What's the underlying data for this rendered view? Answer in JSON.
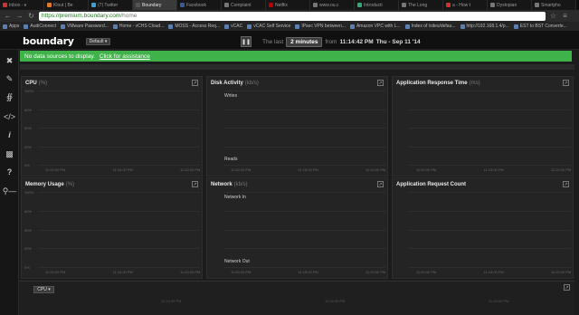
{
  "browser": {
    "tabs": [
      {
        "label": "Inbox - e",
        "color": "#c33"
      },
      {
        "label": "Klout | Be",
        "color": "#e07a2a"
      },
      {
        "label": "(7) Twitter",
        "color": "#3ba0d8"
      },
      {
        "label": "Boundary",
        "color": "#555",
        "active": true
      },
      {
        "label": "Facebook",
        "color": "#3b5998"
      },
      {
        "label": "Complaint",
        "color": "#777"
      },
      {
        "label": "Netflix",
        "color": "#b00"
      },
      {
        "label": "www.ou.c",
        "color": "#777"
      },
      {
        "label": "Introducti",
        "color": "#3a7"
      },
      {
        "label": "The Long",
        "color": "#777"
      },
      {
        "label": "a - How t",
        "color": "#c33"
      },
      {
        "label": "Dystopian",
        "color": "#777"
      },
      {
        "label": "Smartpho",
        "color": "#777"
      }
    ],
    "url_host": "https://premium.boundary.com",
    "url_path": "/home",
    "bookmarks": [
      "Apps",
      "AudiConnect",
      "VMware Password...",
      "Home - vCHS Cloud...",
      "MOSS - Access Req...",
      "vCAC",
      "vCAC Self Service",
      "IPsec VPN between...",
      "Amazon VPC with L...",
      "Index of /sites/defau...",
      "http://192.168.1.4/p...",
      "EST to BST Converte..."
    ]
  },
  "header": {
    "logo": "boundary",
    "dashboard_select": "Default",
    "pause_icon": "pause-icon",
    "time_prefix": "The last",
    "duration": "2 minutes",
    "from_word": "from",
    "start_time": "11:14:42 PM",
    "date": "Thu - Sep 11 '14"
  },
  "sidebar": {
    "icons": [
      "tools-icon",
      "pencil-icon",
      "share-icon",
      "code-icon",
      "info-icon",
      "chat-icon",
      "help-icon",
      "key-icon"
    ]
  },
  "alert": {
    "text": "No data sources to display.",
    "link": "Click for assistance",
    "color": "#3fb249"
  },
  "panels": [
    {
      "id": "cpu",
      "title": "CPU",
      "unit": "(%)",
      "yticks": [
        "100%",
        "80%",
        "50%",
        "20%",
        "0%"
      ],
      "xticks": [
        "11:00:00 PM",
        "11:15:00 PM",
        "11:20:00 PM"
      ],
      "labels": []
    },
    {
      "id": "disk",
      "title": "Disk Activity",
      "unit": "(kb/s)",
      "yticks": [
        "",
        "",
        "",
        "",
        ""
      ],
      "xticks": [
        "11:00:00 PM",
        "11:15:00 PM",
        "11:20:00 PM"
      ],
      "labels": [
        "Writes",
        "Reads"
      ]
    },
    {
      "id": "art",
      "title": "Application Response Time",
      "unit": "(ms)",
      "yticks": [
        "",
        "",
        "",
        "",
        ""
      ],
      "xticks": [
        "11:00:00 PM",
        "11:15:00 PM",
        "11:20:00 PM"
      ],
      "labels": []
    },
    {
      "id": "mem",
      "title": "Memory Usage",
      "unit": "(%)",
      "yticks": [
        "100%",
        "80%",
        "50%",
        "20%",
        "0%"
      ],
      "xticks": [
        "11:00:00 PM",
        "11:15:00 PM",
        "11:20:00 PM"
      ],
      "labels": []
    },
    {
      "id": "net",
      "title": "Network",
      "unit": "(kb/s)",
      "yticks": [
        "",
        "",
        "",
        "",
        ""
      ],
      "xticks": [
        "11:00:00 PM",
        "11:15:00 PM",
        "11:20:00 PM"
      ],
      "labels": [
        "Network In",
        "Network Out"
      ]
    },
    {
      "id": "arc",
      "title": "Application Request Count",
      "unit": "",
      "yticks": [
        "",
        "",
        "",
        "",
        ""
      ],
      "xticks": [
        "11:00:00 PM",
        "11:15:00 PM",
        "11:20:00 PM"
      ],
      "labels": []
    }
  ],
  "bottom": {
    "select": "CPU",
    "xticks": [
      "11:14:00 PM",
      "11:15:00 PM",
      "11:16:00 PM"
    ]
  }
}
